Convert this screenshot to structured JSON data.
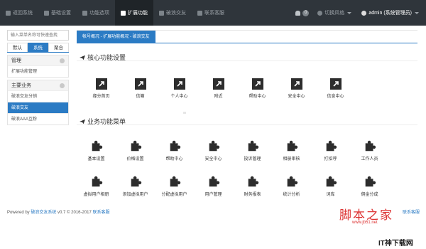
{
  "nav": {
    "items": [
      {
        "label": "返回系统",
        "icon": "home-icon",
        "active": false
      },
      {
        "label": "基础设置",
        "icon": "settings-icon",
        "active": false
      },
      {
        "label": "功能选项",
        "icon": "options-icon",
        "active": false
      },
      {
        "label": "扩展功能",
        "icon": "users-icon",
        "active": true
      },
      {
        "label": "破浪交友",
        "icon": "chat-icon",
        "active": false
      },
      {
        "label": "联系客服",
        "icon": "service-icon",
        "active": false
      }
    ],
    "notifications": "0",
    "theme_label": "切换风格",
    "user_label": "admin (系统管理员)"
  },
  "sidebar": {
    "search_placeholder": "输入菜单名称可快速查找",
    "tabs": [
      {
        "label": "默认",
        "active": false
      },
      {
        "label": "系统",
        "active": true
      },
      {
        "label": "聚合",
        "active": false
      }
    ],
    "groups": [
      {
        "title": "管理",
        "items": [
          {
            "label": "扩展功能管理",
            "active": false
          }
        ]
      },
      {
        "title": "主要业务",
        "items": [
          {
            "label": "破浪交友分销",
            "active": false
          },
          {
            "label": "破浪交友",
            "active": true
          },
          {
            "label": "破浪AAA互粉",
            "active": false
          }
        ]
      }
    ]
  },
  "main": {
    "breadcrumb": "帐号概况 - 扩展功能概况 - 破浪交友",
    "section1_title": "核心功能设置",
    "section1_items": [
      "缘分首页",
      "信箱",
      "个人中心",
      "附近",
      "帮助中心",
      "安全中心",
      "信息中心"
    ],
    "section2_title": "业务功能菜单",
    "section2_row1": [
      "基本设置",
      "价格设置",
      "帮助中心",
      "安全中心",
      "投诉管理",
      "相册审核",
      "打招呼",
      "工作人员"
    ],
    "section2_row2": [
      "虚拟用户相册",
      "添加虚拟用户",
      "分配虚拟用户",
      "用户管理",
      "财务报表",
      "统计分析",
      "词库",
      "佣金分成"
    ]
  },
  "footer": {
    "prefix": "Powered by",
    "system_link": "破浪交友系统",
    "version": "v0.7 © 2016-2017",
    "service_link": "联系客服",
    "right_link": "联系客服"
  },
  "watermark": {
    "brand": "脚本之家",
    "url": "www.jb51.net",
    "corner": "IT神下载网"
  },
  "colors": {
    "accent": "#2b7bc4",
    "nav_bg": "#2f353b",
    "watermark": "#dd3333"
  }
}
